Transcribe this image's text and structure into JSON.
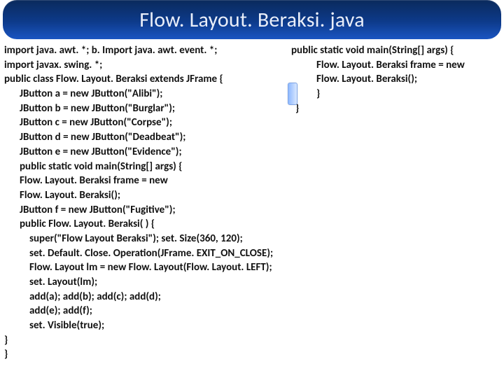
{
  "title": "Flow. Layout. Beraksi. java",
  "left": {
    "l1": "import java. awt. *; b. Import java. awt. event. *;",
    "l2": "import javax. swing. *;",
    "l3": "public class Flow. Layout. Beraksi extends JFrame {",
    "l4": "JButton a = new JButton(\"Alibi\");",
    "l5": "JButton b = new JButton(\"Burglar\");",
    "l6": "JButton c = new JButton(\"Corpse\");",
    "l7": "JButton d = new JButton(\"Deadbeat\");",
    "l8": "JButton e = new JButton(\"Evidence\");",
    "l9": "public static void main(String[] args) {",
    "l10": "Flow. Layout. Beraksi frame = new",
    "l11": "Flow. Layout. Beraksi();",
    "l12": "JButton f = new JButton(\"Fugitive\");",
    "l13": "public Flow. Layout. Beraksi( ) {",
    "l14": "super(\"Flow Layout Beraksi\"); set. Size(360, 120);",
    "l15": "set. Default. Close. Operation(JFrame. EXIT_ON_CLOSE);",
    "l16": "Flow. Layout lm = new Flow. Layout(Flow. Layout. LEFT);",
    "l17": "set. Layout(lm);",
    "l18": "add(a); add(b); add(c); add(d);",
    "l19": "add(e); add(f);",
    "l20": "set. Visible(true);",
    "l21": "}",
    "l22": "}"
  },
  "right": {
    "r1": "public static void main(String[] args) {",
    "r2": "Flow. Layout. Beraksi frame = new",
    "r3": "Flow. Layout. Beraksi();",
    "r4": "}",
    "r5": "}"
  }
}
